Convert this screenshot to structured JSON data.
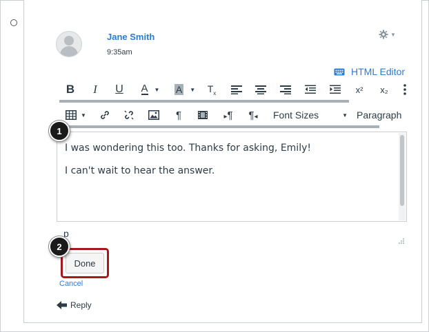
{
  "author": {
    "name": "Jane Smith",
    "time": "9:35am"
  },
  "editor_toggle": {
    "label": "HTML Editor"
  },
  "toolbar": {
    "font_sizes_label": "Font Sizes",
    "paragraph_label": "Paragraph",
    "superscript_label": "x²",
    "subscript_label": "x₂"
  },
  "editor": {
    "line1": "I was wondering this too. Thanks for asking, Emily!",
    "line2": "I can't wait to hear the answer.",
    "path_indicator": "p"
  },
  "callouts": {
    "first": "1",
    "second": "2"
  },
  "actions": {
    "done_label": "Done",
    "cancel_label": "Cancel",
    "reply_label": "Reply"
  },
  "colors": {
    "link": "#2d7bd0",
    "callout_border": "#a3191d",
    "text": "#2d3b45"
  }
}
